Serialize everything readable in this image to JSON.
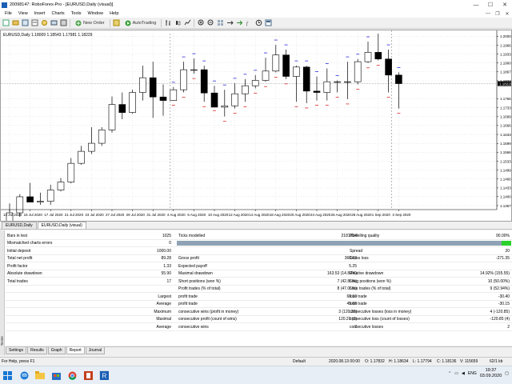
{
  "window": {
    "title": "20098147: RoboForex-Pro - [EURUSD,Daily (visual)]",
    "controls": [
      "—",
      "☐",
      "✕"
    ]
  },
  "menu": {
    "items": [
      "File",
      "View",
      "Insert",
      "Charts",
      "Tools",
      "Window",
      "Help"
    ],
    "mdi_controls": [
      "—",
      "❐",
      "✕"
    ]
  },
  "toolbar": {
    "new_order_label": "New Order",
    "autotrading_label": "AutoTrading"
  },
  "chart": {
    "label": "EURUSD,Daily  1.18009 1.18543 1.17981 1.18229",
    "price_labels": [
      "1.20000",
      "1.19665",
      "1.19330",
      "1.19005",
      "1.18670",
      "1.18335",
      "1.17665",
      "1.17330",
      "1.16995",
      "1.16665",
      "1.16330",
      "1.15995",
      "1.15665",
      "1.15330",
      "1.14995",
      "1.14665",
      "1.14330",
      "1.14005",
      "1.13670"
    ],
    "current_price": "1.18229",
    "date_labels": [
      "13 Jul 2020",
      "15 Jul 2020",
      "17 Jul 2020",
      "21 Jul 2020",
      "23 Jul 2020",
      "27 Jul 2020",
      "29 Jul 2020",
      "31 Jul 2020",
      "4 Aug 2020",
      "6 Aug 2020",
      "10 Aug 2020",
      "12 Aug 2020",
      "14 Aug 2020",
      "18 Aug 2020",
      "20 Aug 2020",
      "24 Aug 2020",
      "26 Aug 2020",
      "28 Aug 2020",
      "1 Sep 2020",
      "3 Sep 2020"
    ],
    "tabs": [
      "EURUSD,Daily",
      "EURUSD,Daily (visual)"
    ]
  },
  "chart_data": {
    "type": "candlestick",
    "x": [
      "13 Jul 2020",
      "14 Jul 2020",
      "15 Jul 2020",
      "16 Jul 2020",
      "17 Jul 2020",
      "20 Jul 2020",
      "21 Jul 2020",
      "22 Jul 2020",
      "23 Jul 2020",
      "24 Jul 2020",
      "27 Jul 2020",
      "28 Jul 2020",
      "29 Jul 2020",
      "30 Jul 2020",
      "31 Jul 2020",
      "3 Aug 2020",
      "4 Aug 2020",
      "5 Aug 2020",
      "6 Aug 2020",
      "7 Aug 2020",
      "10 Aug 2020",
      "11 Aug 2020",
      "12 Aug 2020",
      "13 Aug 2020",
      "14 Aug 2020",
      "17 Aug 2020",
      "18 Aug 2020",
      "19 Aug 2020",
      "20 Aug 2020",
      "21 Aug 2020",
      "24 Aug 2020",
      "25 Aug 2020",
      "26 Aug 2020",
      "27 Aug 2020",
      "28 Aug 2020",
      "31 Aug 2020",
      "1 Sep 2020",
      "2 Sep 2020",
      "3 Sep 2020"
    ],
    "open": [
      1.13,
      1.134,
      1.14,
      1.138,
      1.1383,
      1.1425,
      1.1455,
      1.1525,
      1.157,
      1.16,
      1.165,
      1.1745,
      1.1715,
      1.179,
      1.1845,
      1.1773,
      1.176,
      1.18,
      1.1875,
      1.1875,
      1.1788,
      1.1735,
      1.174,
      1.1785,
      1.1815,
      1.1835,
      1.187,
      1.193,
      1.185,
      1.1885,
      1.1795,
      1.179,
      1.183,
      1.183,
      1.183,
      1.1905,
      1.194,
      1.1915,
      1.1855
    ],
    "high": [
      1.1375,
      1.141,
      1.1452,
      1.1415,
      1.1445,
      1.147,
      1.1545,
      1.159,
      1.166,
      1.166,
      1.1775,
      1.179,
      1.18,
      1.189,
      1.1905,
      1.182,
      1.181,
      1.1905,
      1.1917,
      1.189,
      1.1815,
      1.18,
      1.1825,
      1.184,
      1.1855,
      1.192,
      1.1968,
      1.195,
      1.189,
      1.189,
      1.185,
      1.188,
      1.1835,
      1.1905,
      1.1915,
      1.198,
      1.201,
      1.195,
      1.1865
    ],
    "low": [
      1.129,
      1.1325,
      1.1385,
      1.137,
      1.137,
      1.142,
      1.145,
      1.152,
      1.156,
      1.159,
      1.164,
      1.169,
      1.171,
      1.176,
      1.1695,
      1.1703,
      1.176,
      1.179,
      1.186,
      1.1755,
      1.174,
      1.17,
      1.173,
      1.1755,
      1.1805,
      1.183,
      1.1865,
      1.184,
      1.1755,
      1.175,
      1.176,
      1.176,
      1.179,
      1.1765,
      1.182,
      1.19,
      1.191,
      1.179,
      1.173
    ],
    "close": [
      1.134,
      1.14,
      1.138,
      1.1383,
      1.1425,
      1.1455,
      1.1525,
      1.157,
      1.16,
      1.165,
      1.1745,
      1.1715,
      1.179,
      1.1845,
      1.1773,
      1.176,
      1.18,
      1.1875,
      1.1875,
      1.1788,
      1.1735,
      1.174,
      1.1785,
      1.1815,
      1.1835,
      1.187,
      1.193,
      1.185,
      1.1885,
      1.1795,
      1.179,
      1.183,
      1.183,
      1.183,
      1.1905,
      1.194,
      1.1915,
      1.1855,
      1.1823
    ],
    "ylim": [
      1.1352,
      1.201
    ],
    "grid": true
  },
  "report": {
    "rows": [
      [
        "Bars in test",
        "1025",
        "Ticks modelled",
        "2181734",
        "Modelling quality",
        "90.00%"
      ],
      [
        "Mismatched charts errors",
        "0",
        "",
        "",
        "",
        ""
      ],
      [
        "Initial deposit",
        "1000.00",
        "",
        "",
        "Spread",
        "20"
      ],
      [
        "Total net profit",
        "89.28",
        "Gross profit",
        "360.63",
        "Gross loss",
        "-271.35"
      ],
      [
        "Profit factor",
        "1.33",
        "Expected payoff",
        "5.25",
        "",
        ""
      ],
      [
        "Absolute drawdown",
        "55.90",
        "Maximal drawdown",
        "163.53 (14.82%)",
        "Relative drawdown",
        "14.92% (155.55)"
      ],
      [
        "Total trades",
        "17",
        "Short positions (won %)",
        "7 (42.86%)",
        "Long positions (won %)",
        "10 (50.00%)"
      ],
      [
        "",
        "",
        "Profit trades (% of total)",
        "8 (47.06%)",
        "Loss trades (% of total)",
        "9 (52.94%)"
      ],
      [
        "",
        "Largest",
        "profit trade",
        "60.10",
        "loss trade",
        "-30.40"
      ],
      [
        "",
        "Average",
        "profit trade",
        "45.08",
        "loss trade",
        "-30.15"
      ],
      [
        "",
        "Maximum",
        "consecutive wins (profit in money)",
        "3 (120.20)",
        "consecutive losses (loss in money)",
        "4 (-120.85)"
      ],
      [
        "",
        "Maximal",
        "consecutive profit (count of wins)",
        "120.20 (3)",
        "consecutive loss (count of losses)",
        "-120.85 (4)"
      ],
      [
        "",
        "Average",
        "consecutive wins",
        "2",
        "consecutive losses",
        "2"
      ]
    ],
    "tabs": [
      "Settings",
      "Results",
      "Graph",
      "Report",
      "Journal"
    ],
    "side_label": "Tester"
  },
  "status": {
    "help": "For Help, press F1",
    "profile": "Default",
    "datetime": "2020.08.13 00:00",
    "open": "O: 1.17832",
    "high": "H: 1.18634",
    "low": "L: 1.17794",
    "close": "C: 1.18136",
    "volume": "V: 115659",
    "traffic": "62/1 kb"
  },
  "taskbar": {
    "time": "19:37",
    "date": "03.09.2020",
    "language": "ENG"
  }
}
